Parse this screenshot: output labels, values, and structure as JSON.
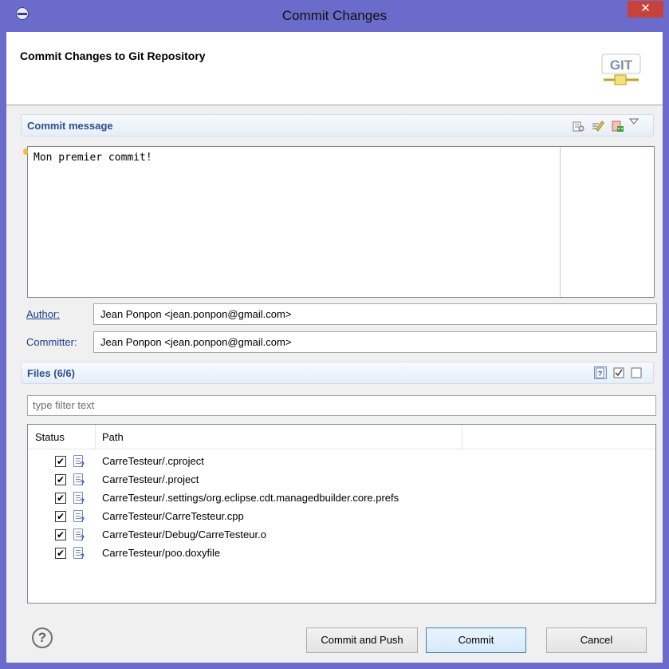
{
  "window": {
    "title": "Commit Changes",
    "close_glyph": "✕"
  },
  "header": {
    "title": "Commit Changes to Git Repository",
    "logo_text": "GIT"
  },
  "commit_message": {
    "section_label": "Commit message",
    "text": "Mon premier commit!",
    "toolbar_icons": [
      "previous-messages-icon",
      "add-signed-off-by-icon",
      "amend-commit-icon",
      "view-menu-icon"
    ]
  },
  "author": {
    "label": "Author:",
    "value": "Jean Ponpon <jean.ponpon@gmail.com>"
  },
  "committer": {
    "label": "Committer:",
    "value": "Jean Ponpon <jean.ponpon@gmail.com>"
  },
  "files": {
    "section_label": "Files (6/6)",
    "filter_placeholder": "type filter text",
    "columns": [
      "Status",
      "Path"
    ],
    "rows": [
      {
        "checked": "✔",
        "path": "CarreTesteur/.cproject",
        "icon": "untracked-file-icon"
      },
      {
        "checked": "✔",
        "path": "CarreTesteur/.project",
        "icon": "untracked-file-icon"
      },
      {
        "checked": "✔",
        "path": "CarreTesteur/.settings/org.eclipse.cdt.managedbuilder.core.prefs",
        "icon": "untracked-file-icon"
      },
      {
        "checked": "✔",
        "path": "CarreTesteur/CarreTesteur.cpp",
        "icon": "untracked-cpp-file-icon"
      },
      {
        "checked": "✔",
        "path": "CarreTesteur/Debug/CarreTesteur.o",
        "icon": "untracked-binary-file-icon"
      },
      {
        "checked": "✔",
        "path": "CarreTesteur/poo.doxyfile",
        "icon": "untracked-file-icon"
      }
    ]
  },
  "buttons": {
    "help": "?",
    "commit_and_push": "Commit and Push",
    "commit": "Commit",
    "cancel": "Cancel"
  },
  "colors": {
    "title_bar": "#6b6bcb",
    "close_button": "#c7423b",
    "section_label": "#2f4e8c",
    "default_button_border": "#3c7fb1"
  }
}
